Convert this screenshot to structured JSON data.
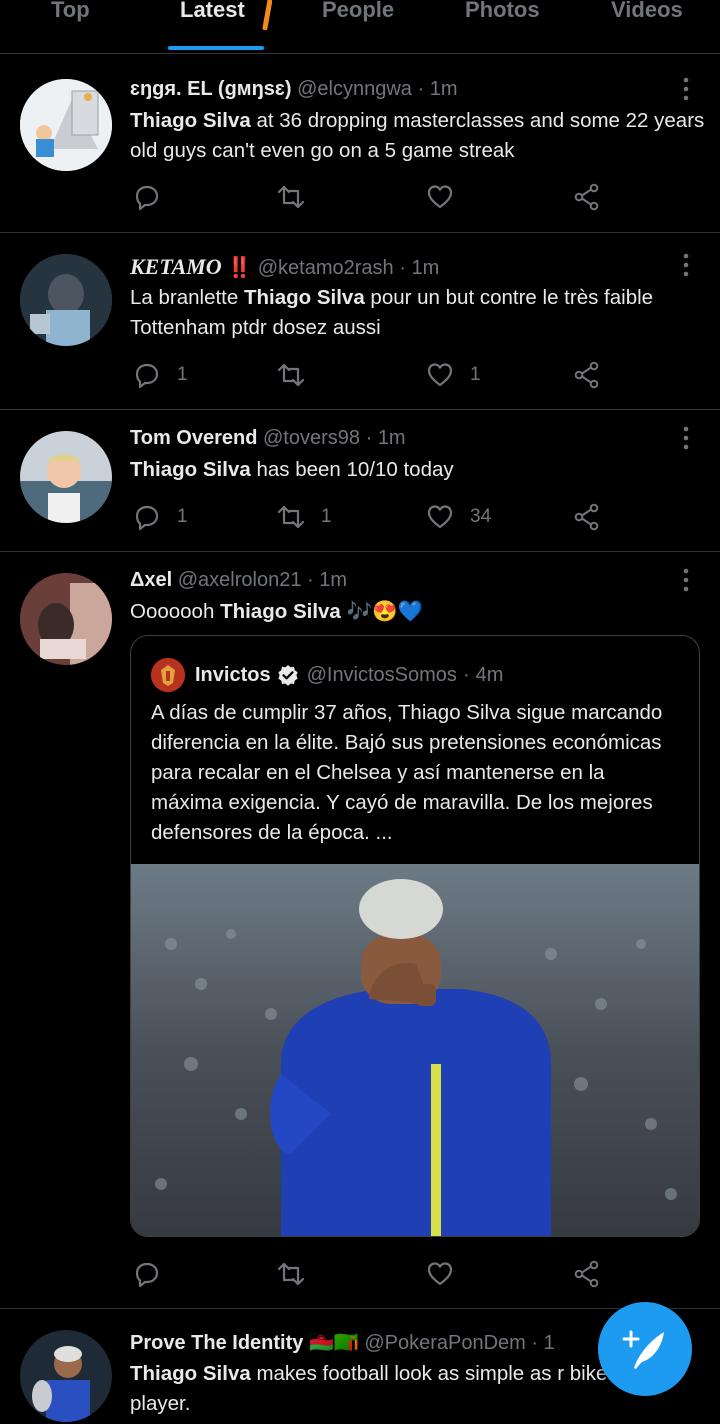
{
  "tabs": [
    "Top",
    "Latest",
    "People",
    "Photos",
    "Videos"
  ],
  "tweets": [
    {
      "name": "ɛŋɡя. EL (ɡмŋsɛ)",
      "handle": "@elcynngwa",
      "time": "1m",
      "highlight": "Thiago Silva",
      "text": " at 36 dropping masterclasses and some 22 years old guys can't even go on a 5 game streak",
      "replies": "",
      "retweets": "",
      "likes": ""
    },
    {
      "name": "KETAMO",
      "badge": "‼️",
      "handle": "@ketamo2rash",
      "time": "1m",
      "pre": "La branlette ",
      "highlight": "Thiago Silva",
      "text": " pour un but contre le très faible Tottenham ptdr dosez aussi",
      "replies": "1",
      "retweets": "",
      "likes": "1"
    },
    {
      "name": "Tom Overend",
      "handle": "@tovers98",
      "time": "1m",
      "highlight": "Thiago Silva",
      "text": " has been 10/10 today",
      "replies": "1",
      "retweets": "1",
      "likes": "34"
    },
    {
      "name": "Δxel",
      "handle": "@axelrolon21",
      "time": "1m",
      "pre": "Ooooooh ",
      "highlight": "Thiago Silva",
      "text": " 🎶😍💙",
      "replies": "",
      "retweets": "",
      "likes": "",
      "quote": {
        "name": "Invictos",
        "handle": "@InvictosSomos",
        "time": "4m",
        "text": "A días de cumplir 37 años, Thiago Silva sigue marcando diferencia en la élite. Bajó sus pretensiones económicas para recalar en el Chelsea y así mantenerse en la máxima exigencia. Y cayó de maravilla. De los mejores defensores de la época. ..."
      }
    },
    {
      "name": "Prove The Identity",
      "flags": "🇲🇼🇿🇲",
      "handle": "@PokeraPonDem",
      "time": "1",
      "highlight": "Thiago Silva",
      "text": " makes football look as simple as r bike. Unreal player."
    }
  ],
  "separator": "·",
  "colors": {
    "accent": "#1d9bf0",
    "background": "#000000",
    "secondary_text": "#71767b",
    "border": "#2f3336"
  },
  "icons": {
    "reply": "reply-icon",
    "retweet": "retweet-icon",
    "like": "heart-icon",
    "share": "share-icon",
    "more": "more-vertical-icon",
    "compose": "compose-tweet-icon",
    "verified": "verified-badge-icon"
  }
}
